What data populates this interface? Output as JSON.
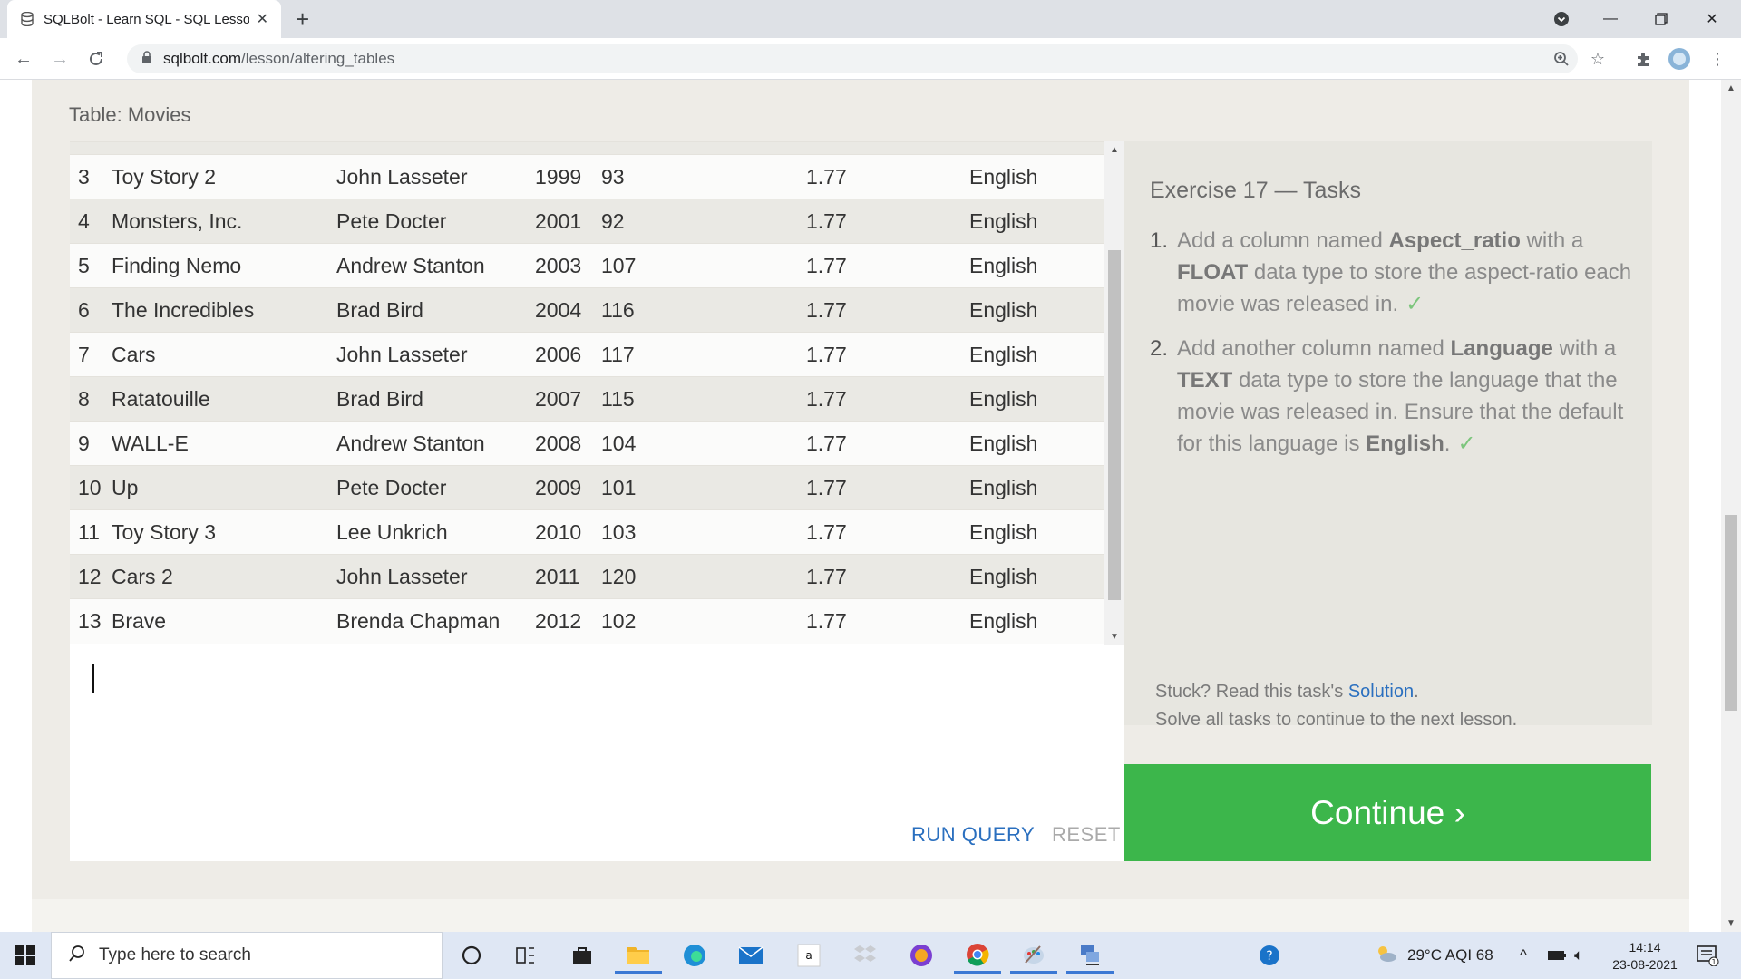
{
  "browser": {
    "tab_title": "SQLBolt - Learn SQL - SQL Lesson",
    "new_tab": "+",
    "url_host": "sqlbolt.com",
    "url_path": "/lesson/altering_tables"
  },
  "lesson": {
    "table_caption": "Table: Movies",
    "rows": [
      {
        "id": "3",
        "title": "Toy Story 2",
        "director": "John Lasseter",
        "year": "1999",
        "length": "93",
        "aspect": "1.77",
        "language": "English"
      },
      {
        "id": "4",
        "title": "Monsters, Inc.",
        "director": "Pete Docter",
        "year": "2001",
        "length": "92",
        "aspect": "1.77",
        "language": "English"
      },
      {
        "id": "5",
        "title": "Finding Nemo",
        "director": "Andrew Stanton",
        "year": "2003",
        "length": "107",
        "aspect": "1.77",
        "language": "English"
      },
      {
        "id": "6",
        "title": "The Incredibles",
        "director": "Brad Bird",
        "year": "2004",
        "length": "116",
        "aspect": "1.77",
        "language": "English"
      },
      {
        "id": "7",
        "title": "Cars",
        "director": "John Lasseter",
        "year": "2006",
        "length": "117",
        "aspect": "1.77",
        "language": "English"
      },
      {
        "id": "8",
        "title": "Ratatouille",
        "director": "Brad Bird",
        "year": "2007",
        "length": "115",
        "aspect": "1.77",
        "language": "English"
      },
      {
        "id": "9",
        "title": "WALL-E",
        "director": "Andrew Stanton",
        "year": "2008",
        "length": "104",
        "aspect": "1.77",
        "language": "English"
      },
      {
        "id": "10",
        "title": "Up",
        "director": "Pete Docter",
        "year": "2009",
        "length": "101",
        "aspect": "1.77",
        "language": "English"
      },
      {
        "id": "11",
        "title": "Toy Story 3",
        "director": "Lee Unkrich",
        "year": "2010",
        "length": "103",
        "aspect": "1.77",
        "language": "English"
      },
      {
        "id": "12",
        "title": "Cars 2",
        "director": "John Lasseter",
        "year": "2011",
        "length": "120",
        "aspect": "1.77",
        "language": "English"
      },
      {
        "id": "13",
        "title": "Brave",
        "director": "Brenda Chapman",
        "year": "2012",
        "length": "102",
        "aspect": "1.77",
        "language": "English"
      }
    ],
    "run_query": "RUN QUERY",
    "reset": "RESET",
    "exercise_title": "Exercise 17 — Tasks",
    "tasks": [
      {
        "num": "1.",
        "pre": "Add a column named ",
        "b1": "Aspect_ratio",
        "mid": " with a ",
        "b2": "FLOAT",
        "post": " data type to store the aspect-ratio each movie was released in.",
        "check": "✓"
      },
      {
        "num": "2.",
        "pre": "Add another column named ",
        "b1": "Language",
        "mid": " with a ",
        "b2": "TEXT",
        "post": " data type to store the language that the movie was released in. Ensure that the default for this language is ",
        "b3": "English",
        "post2": ".",
        "check": "✓"
      }
    ],
    "stuck_pre": "Stuck? Read this task's ",
    "solution_link": "Solution",
    "stuck_post": ".",
    "solve_all": "Solve all tasks to continue to the next lesson.",
    "continue": "Continue ›"
  },
  "taskbar": {
    "search_placeholder": "Type here to search",
    "weather": "29°C  AQI 68",
    "time": "14:14",
    "date": "23-08-2021",
    "notif_count": "1"
  },
  "colors": {
    "continue_bg": "#3cb64b",
    "link": "#2a6fbf",
    "lesson_bg": "#eeece7"
  }
}
